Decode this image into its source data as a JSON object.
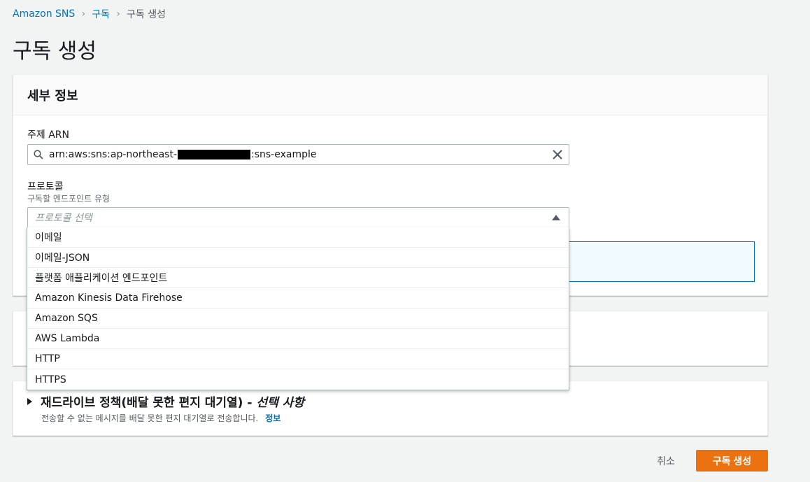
{
  "breadcrumb": {
    "items": [
      "Amazon SNS",
      "구독",
      "구독 생성"
    ]
  },
  "page_title": "구독 생성",
  "details": {
    "header": "세부 정보",
    "topic_arn": {
      "label": "주제 ARN",
      "value_prefix": "arn:aws:sns:ap-northeast-",
      "value_suffix": ":sns-example"
    },
    "protocol": {
      "label": "프로토콜",
      "description": "구독할 엔드포인트 유형",
      "placeholder": "프로토콜 선택",
      "options": [
        "이메일",
        "이메일-JSON",
        "플랫폼 애플리케이션 엔드포인트",
        "Amazon Kinesis Data Firehose",
        "Amazon SQS",
        "AWS Lambda",
        "HTTP",
        "HTTPS"
      ]
    }
  },
  "redrive": {
    "title": "재드라이브 정책(배달 못한 편지 대기열) -",
    "optional": "선택 사항",
    "description": "전송할 수 없는 메시지를 배달 못한 편지 대기열로 전송합니다.",
    "info_link": "정보"
  },
  "footer": {
    "cancel_label": "취소",
    "create_label": "구독 생성"
  },
  "colors": {
    "primary_button": "#ec7211",
    "link": "#0073bb"
  }
}
